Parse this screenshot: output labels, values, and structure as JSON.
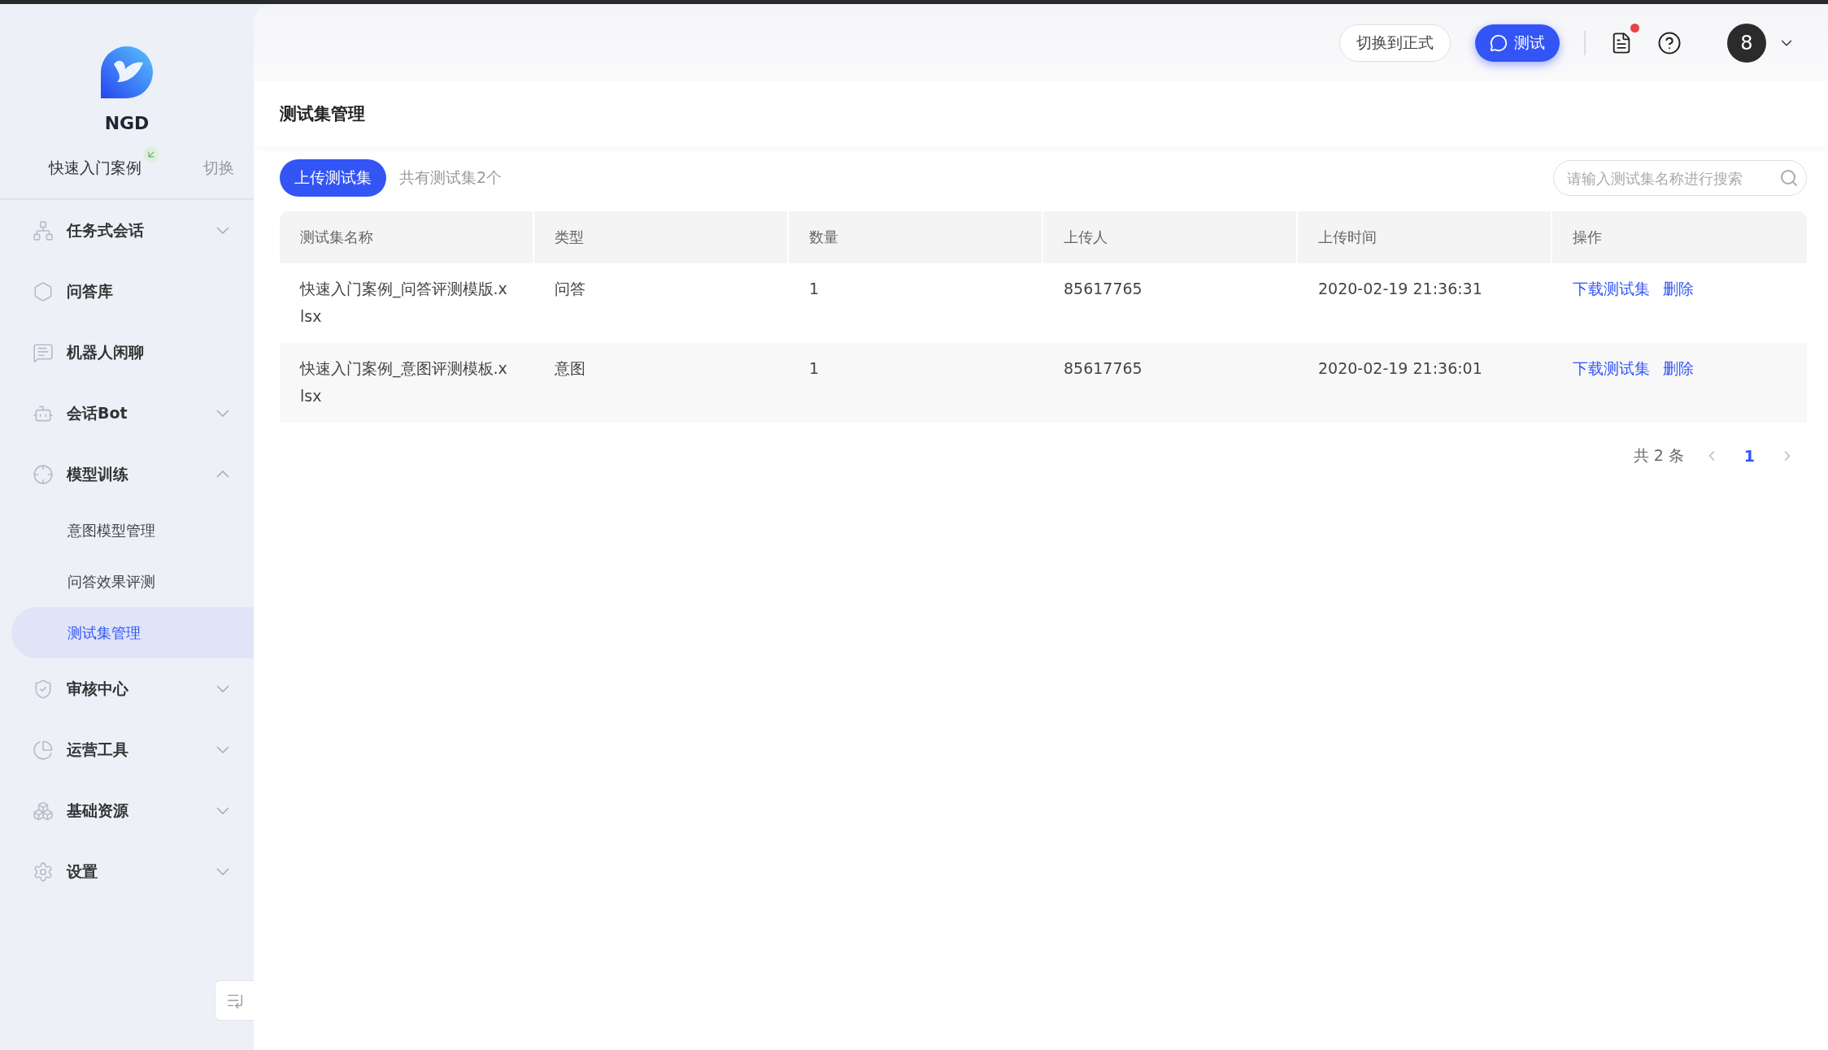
{
  "sidebar": {
    "brand": "NGD",
    "workspace": "快速入门案例",
    "switch_label": "切换",
    "items": [
      {
        "kind": "group",
        "label": "任务式会话",
        "expanded": false
      },
      {
        "kind": "link",
        "label": "问答库"
      },
      {
        "kind": "link",
        "label": "机器人闲聊"
      },
      {
        "kind": "group",
        "label": "会话Bot",
        "expanded": false
      },
      {
        "kind": "group",
        "label": "模型训练",
        "expanded": true,
        "children": [
          {
            "label": "意图模型管理",
            "selected": false
          },
          {
            "label": "问答效果评测",
            "selected": false
          },
          {
            "label": "测试集管理",
            "selected": true
          }
        ]
      },
      {
        "kind": "group",
        "label": "审核中心",
        "expanded": false
      },
      {
        "kind": "group",
        "label": "运营工具",
        "expanded": false
      },
      {
        "kind": "group",
        "label": "基础资源",
        "expanded": false
      },
      {
        "kind": "group",
        "label": "设置",
        "expanded": false
      }
    ]
  },
  "header": {
    "switch_button": "切换到正式",
    "test_button": "测试",
    "notes_badge": true,
    "avatar": "8"
  },
  "page_title": "测试集管理",
  "toolbar": {
    "upload_button": "上传测试集",
    "count": "共有测试集2个",
    "search": {
      "placeholder": "请输入测试集名称进行搜索"
    }
  },
  "table": {
    "columns": [
      "测试集名称",
      "类型",
      "数量",
      "上传人",
      "上传时间",
      "操作"
    ],
    "rows": [
      {
        "name": "快速入门案例_问答评测模版.xlsx",
        "type": "问答",
        "count": "1",
        "uploader": "85617765",
        "time": "2020-02-19 21:36:31",
        "actions": [
          "下载测试集",
          "删除"
        ]
      },
      {
        "name": "快速入门案例_意图评测模板.xlsx",
        "type": "意图",
        "count": "1",
        "uploader": "85617765",
        "time": "2020-02-19 21:36:01",
        "actions": [
          "下载测试集",
          "删除"
        ]
      }
    ]
  },
  "pagination": {
    "total": "共 2 条",
    "pages": [
      {
        "label": "1",
        "selected": true
      }
    ]
  }
}
